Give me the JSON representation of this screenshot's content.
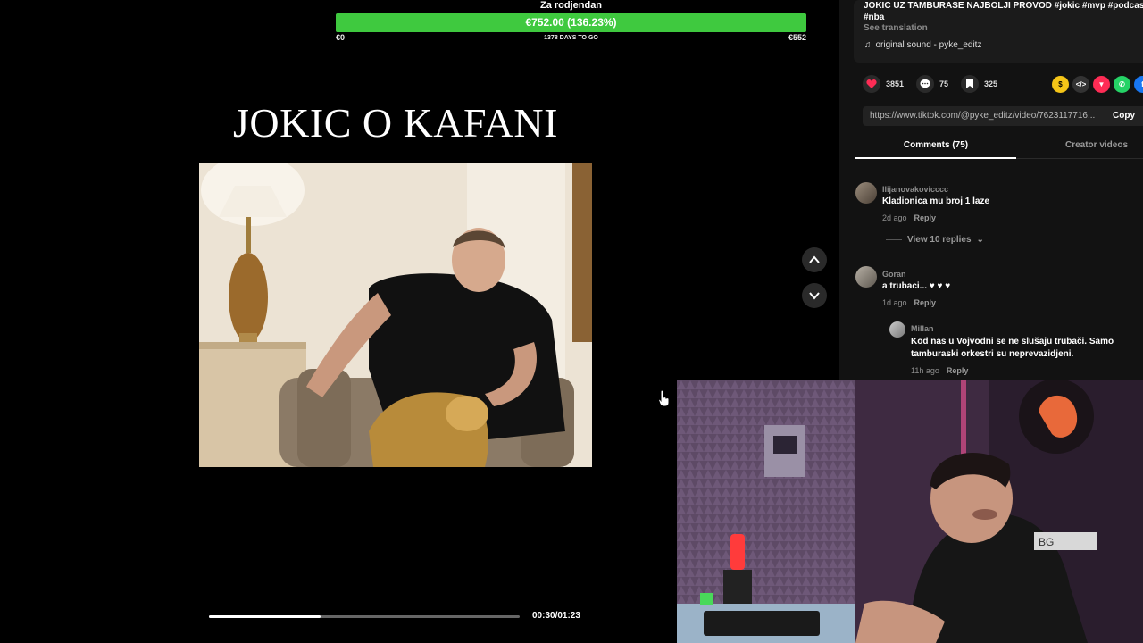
{
  "goal": {
    "title": "Za rodjendan",
    "amount_text": "€752.00 (136.23%)",
    "progress": 1.0,
    "min_label": "€0",
    "days_label": "1378 DAYS TO GO",
    "max_label": "€552"
  },
  "video": {
    "caption": "JOKIC O KAFANI",
    "time": "00:30/01:23",
    "progress": 0.36
  },
  "post": {
    "description": "JOKIC UZ TAMBURASE NAJBOLJI PROVOD #jokic #mvp #podcast #nba",
    "see_translation": "See translation",
    "sound": "original sound - pyke_editz"
  },
  "actions": {
    "likes": "3851",
    "comments": "75",
    "saves": "325",
    "like_color": "#fe2c55"
  },
  "share_icons": [
    "coin-icon",
    "embed-icon",
    "send-icon",
    "whatsapp-icon",
    "facebook-icon"
  ],
  "link": {
    "url": "https://www.tiktok.com/@pyke_editz/video/7623117716...",
    "copy_label": "Copy"
  },
  "tabs": {
    "comments": "Comments (75)",
    "creator": "Creator videos"
  },
  "comments": [
    {
      "user": "Ilijanovakovicccc",
      "text": "Kladionica mu broj 1 laze",
      "time": "2d ago",
      "reply": "Reply",
      "view_replies": "View 10 replies"
    },
    {
      "user": "Goran",
      "text": "a trubaci... ♥ ♥ ♥",
      "time": "1d ago",
      "reply": "Reply"
    }
  ],
  "reply": {
    "user": "Millan",
    "text_line1": "Kod nas u Vojvodni se ne slušaju trubači. Samo",
    "text_line2": "tamburaski orkestri su neprevazidjeni.",
    "time": "11h ago",
    "reply": "Reply"
  }
}
